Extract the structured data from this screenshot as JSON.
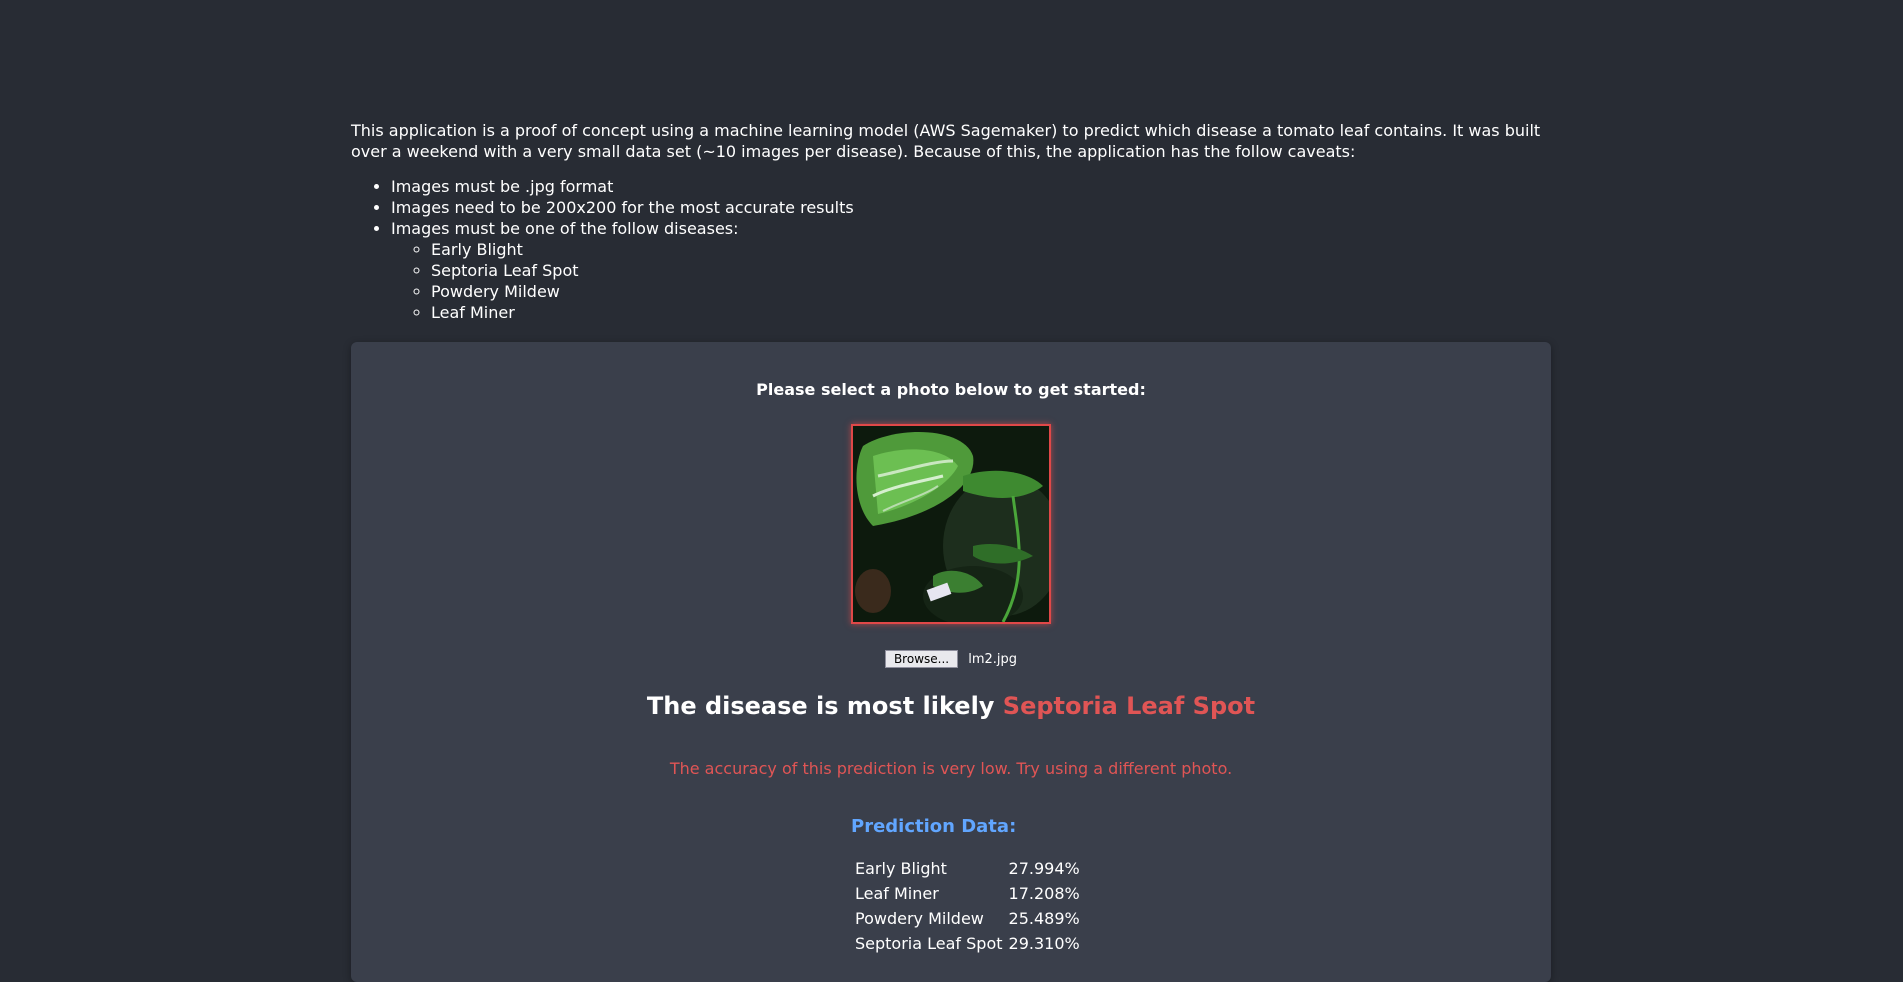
{
  "intro": {
    "paragraph": "This application is a proof of concept using a machine learning model (AWS Sagemaker) to predict which disease a tomato leaf contains. It was built over a weekend with a very small data set (~10 images per disease). Because of this, the application has the follow caveats:",
    "caveats": [
      "Images must be .jpg format",
      "Images need to be 200x200 for the most accurate results",
      "Images must be one of the follow diseases:"
    ],
    "diseases": [
      "Early Blight",
      "Septoria Leaf Spot",
      "Powdery Mildew",
      "Leaf Miner"
    ]
  },
  "card": {
    "prompt": "Please select a photo below to get started:",
    "browse_label": "Browse...",
    "file_name": "lm2.jpg",
    "result_prefix": "The disease is most likely ",
    "result_disease": "Septoria Leaf Spot",
    "warning": "The accuracy of this prediction is very low. Try using a different photo.",
    "prediction_heading": "Prediction Data:",
    "predictions": [
      {
        "name": "Early Blight",
        "value": "27.994%"
      },
      {
        "name": "Leaf Miner",
        "value": "17.208%"
      },
      {
        "name": "Powdery Mildew",
        "value": "25.489%"
      },
      {
        "name": "Septoria Leaf Spot",
        "value": "29.310%"
      }
    ]
  },
  "colors": {
    "background": "#282c34",
    "card": "#3a3f4b",
    "accent_red": "#e05555",
    "accent_blue": "#61a6ff",
    "title_green": "#2fa86a"
  }
}
